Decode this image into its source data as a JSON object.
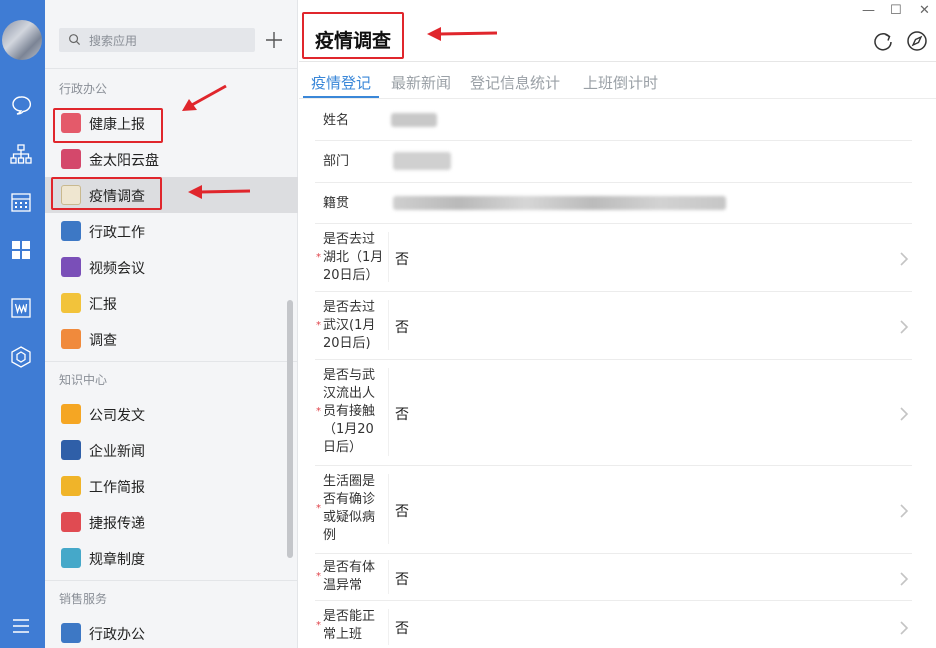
{
  "search": {
    "placeholder": "搜索应用"
  },
  "sections": {
    "admin": "行政办公",
    "knowledge": "知识中心",
    "sales": "销售服务"
  },
  "apps": [
    {
      "label": "健康上报",
      "color": "#e45a6a"
    },
    {
      "label": "金太阳云盘",
      "color": "#d4486b"
    },
    {
      "label": "疫情调查",
      "color": "#e9ddc4"
    },
    {
      "label": "行政工作",
      "color": "#3d78c5"
    },
    {
      "label": "视频会议",
      "color": "#7a4fb8"
    },
    {
      "label": "汇报",
      "color": "#f2c33b"
    },
    {
      "label": "调查",
      "color": "#f08a3c"
    },
    {
      "label": "公司发文",
      "color": "#f5a623"
    },
    {
      "label": "企业新闻",
      "color": "#2f5fa8"
    },
    {
      "label": "工作简报",
      "color": "#f0b429"
    },
    {
      "label": "捷报传递",
      "color": "#e04b52"
    },
    {
      "label": "规章制度",
      "color": "#45a8c9"
    },
    {
      "label": "行政办公",
      "color": "#3d78c5"
    }
  ],
  "main": {
    "title": "疫情调查",
    "tabs": [
      "疫情登记",
      "最新新闻",
      "登记信息统计",
      "上班倒计时"
    ],
    "fields": [
      {
        "label": "姓名"
      },
      {
        "label": "部门"
      },
      {
        "label": "籍贯"
      }
    ],
    "questions": [
      {
        "lines": [
          "是否去过",
          "湖北（1月",
          "20日后）"
        ],
        "value": "否"
      },
      {
        "lines": [
          "是否去过",
          "武汉(1月",
          "20日后)"
        ],
        "value": "否"
      },
      {
        "lines": [
          "是否与武",
          "汉流出人",
          "员有接触",
          "（1月20",
          "日后）"
        ],
        "value": "否"
      },
      {
        "lines": [
          "生活圈是",
          "否有确诊",
          "或疑似病",
          "例"
        ],
        "value": "否"
      },
      {
        "lines": [
          "是否有体",
          "温异常"
        ],
        "value": "否"
      },
      {
        "lines": [
          "是否能正",
          "常上班"
        ],
        "value": "否"
      }
    ]
  },
  "window": {
    "minimize": "—",
    "maximize": "☐",
    "close": "✕"
  },
  "colors": {
    "rail": "#3f7cd4",
    "accent": "#3a87d8",
    "annotation": "#e0262c",
    "required": "#e0434a"
  },
  "icons": {
    "rail": [
      "chat-icon",
      "org-chart-icon",
      "calendar-icon",
      "apps-grid-icon",
      "doc-icon",
      "cube-icon",
      "menu-icon"
    ],
    "header": [
      "refresh-icon",
      "compass-icon"
    ]
  }
}
